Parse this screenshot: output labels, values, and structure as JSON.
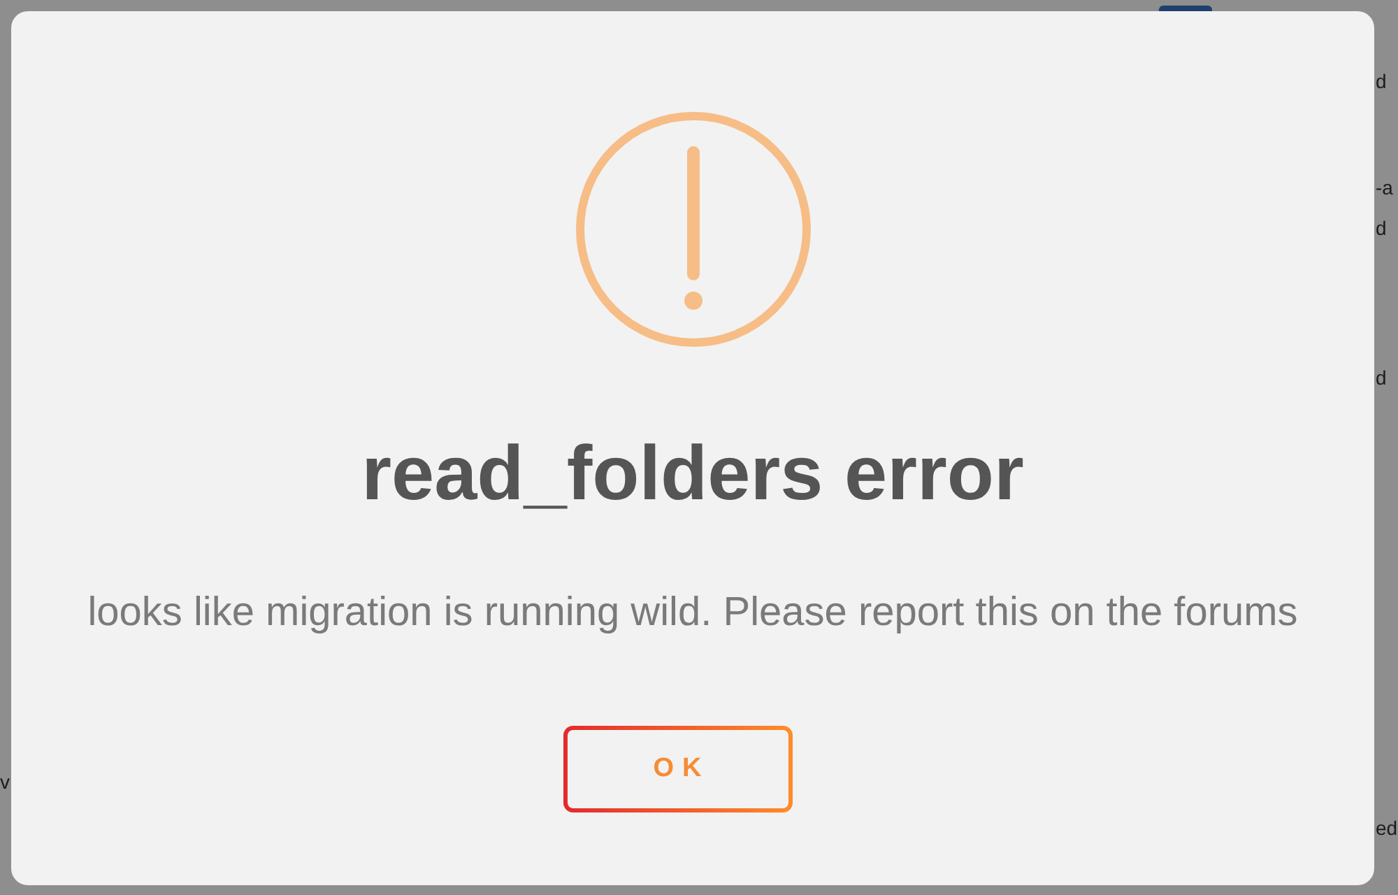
{
  "background": {
    "left_fragments": [
      "v"
    ],
    "right_fragments": [
      "d",
      "-a",
      "d",
      "d",
      "ed"
    ]
  },
  "dialog": {
    "title": "read_folders error",
    "message": "looks like migration is running wild. Please report this on the forums",
    "buttons": [
      {
        "label": "OK",
        "kind": "primary"
      }
    ]
  }
}
